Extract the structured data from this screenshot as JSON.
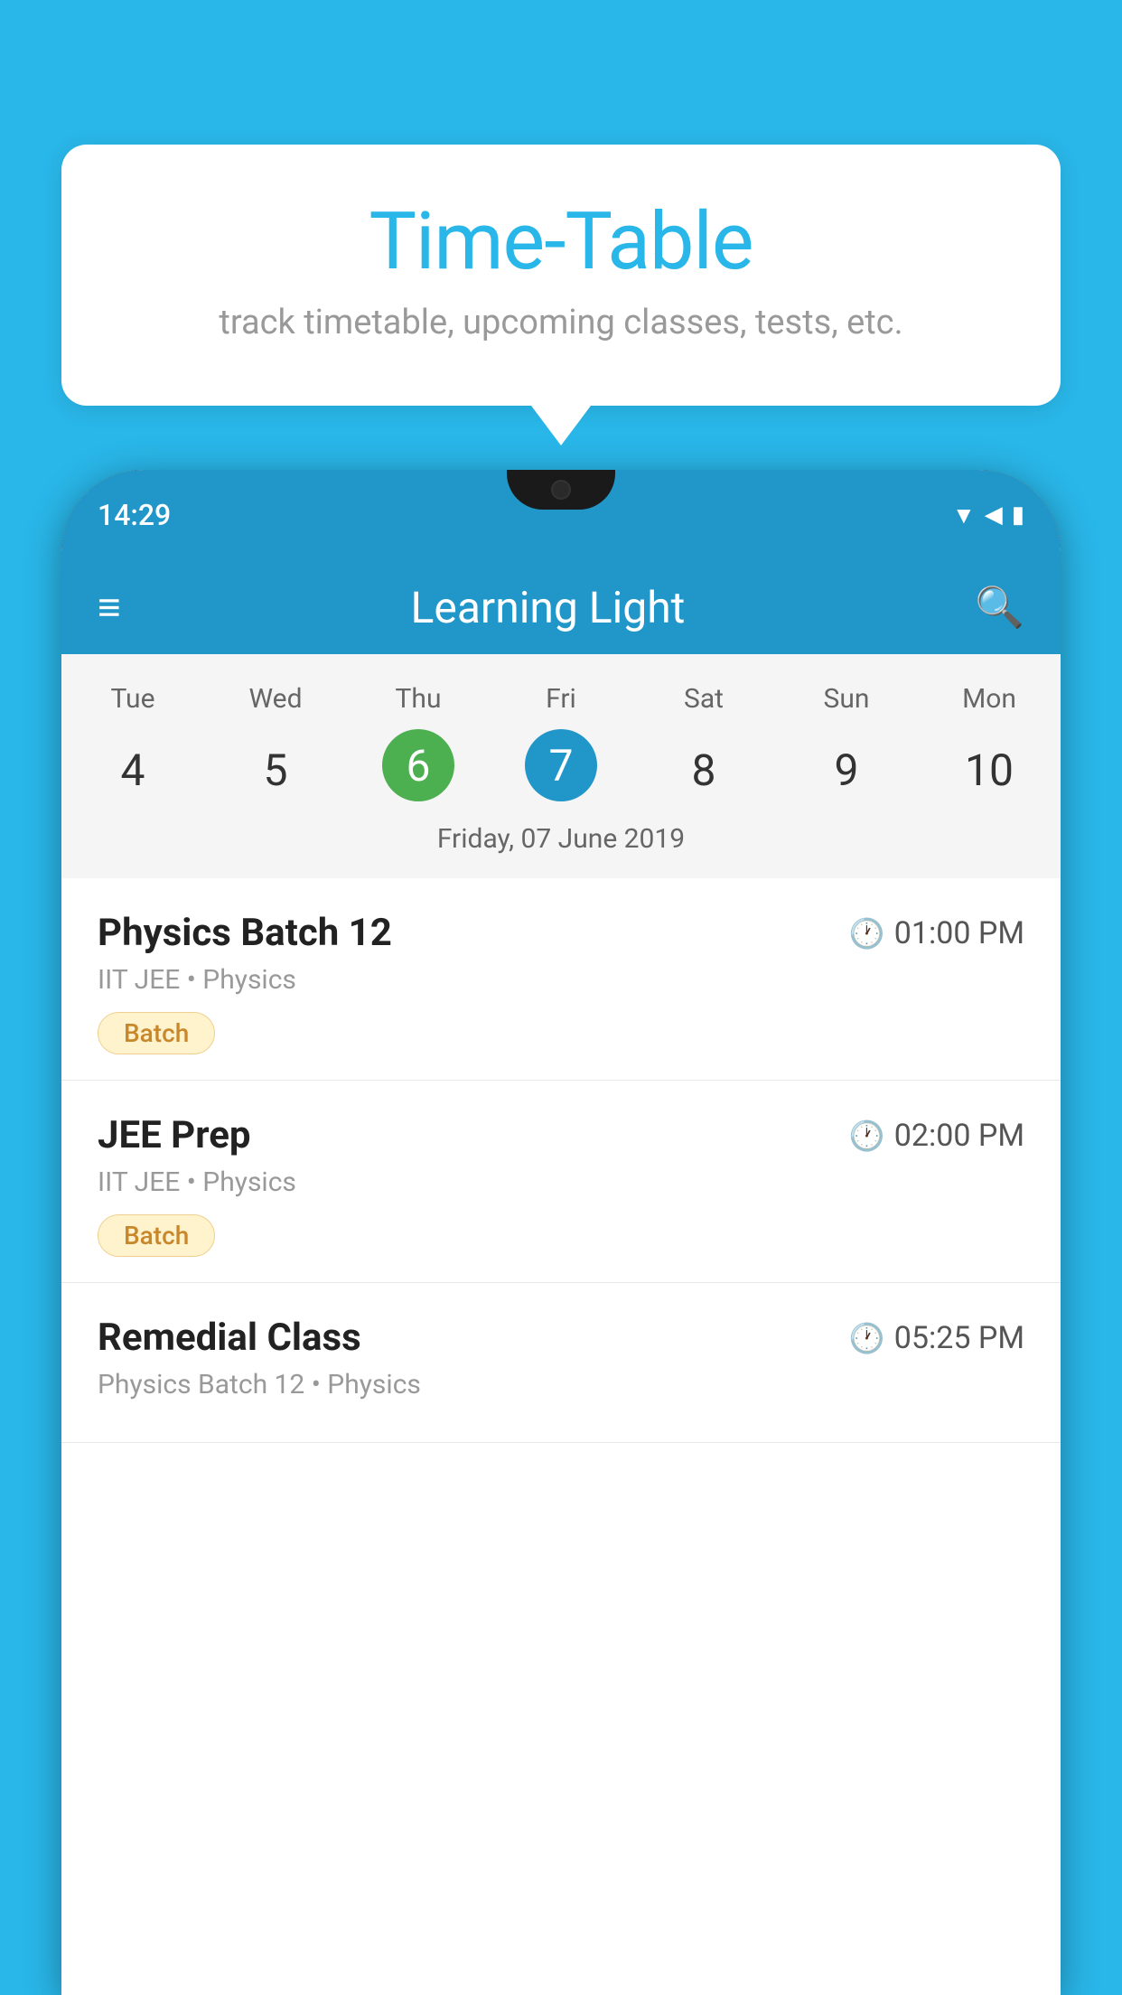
{
  "background_color": "#29B6E8",
  "bubble": {
    "title": "Time-Table",
    "subtitle": "track timetable, upcoming classes, tests, etc."
  },
  "phone": {
    "status_time": "14:29",
    "app_bar_title": "Learning Light"
  },
  "calendar": {
    "days": [
      "Tue",
      "Wed",
      "Thu",
      "Fri",
      "Sat",
      "Sun",
      "Mon"
    ],
    "numbers": [
      "4",
      "5",
      "6",
      "7",
      "8",
      "9",
      "10"
    ],
    "today_index": 2,
    "selected_index": 3,
    "selected_date_label": "Friday, 07 June 2019"
  },
  "classes": [
    {
      "name": "Physics Batch 12",
      "time": "01:00 PM",
      "meta": "IIT JEE • Physics",
      "badge": "Batch"
    },
    {
      "name": "JEE Prep",
      "time": "02:00 PM",
      "meta": "IIT JEE • Physics",
      "badge": "Batch"
    },
    {
      "name": "Remedial Class",
      "time": "05:25 PM",
      "meta": "Physics Batch 12 • Physics",
      "badge": ""
    }
  ],
  "icons": {
    "hamburger": "≡",
    "search": "🔍",
    "clock": "🕐"
  }
}
